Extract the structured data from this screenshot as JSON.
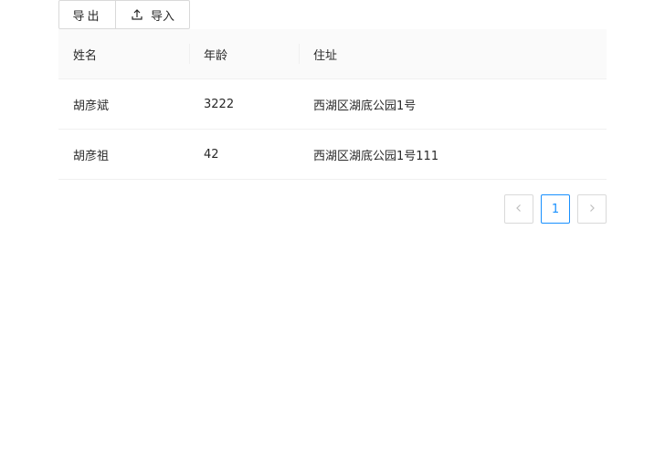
{
  "toolbar": {
    "export_label": "导出",
    "import_label": "导入",
    "import_icon": "upload-icon"
  },
  "table": {
    "columns": [
      "姓名",
      "年龄",
      "住址"
    ],
    "rows": [
      {
        "name": "胡彦斌",
        "age": "3222",
        "address": "西湖区湖底公园1号"
      },
      {
        "name": "胡彦祖",
        "age": "42",
        "address": "西湖区湖底公园1号111"
      }
    ]
  },
  "pagination": {
    "prev_icon": "chevron-left-icon",
    "current_page": "1",
    "next_icon": "chevron-right-icon",
    "accent_color": "#1890ff"
  }
}
